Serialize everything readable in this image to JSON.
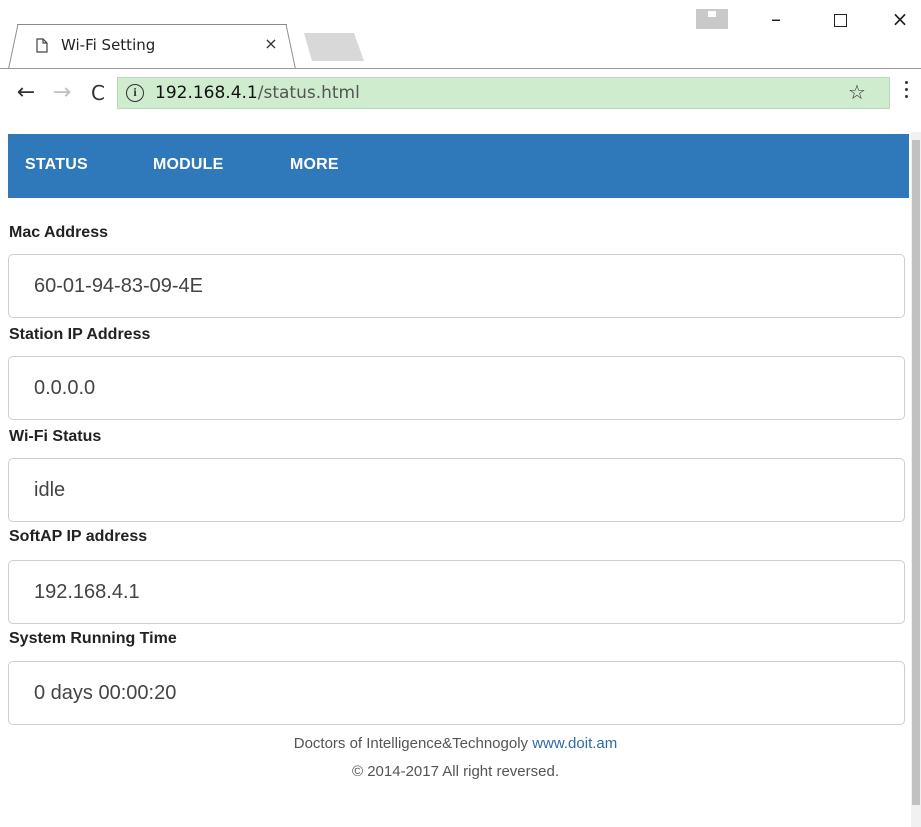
{
  "browser": {
    "tab_title": "Wi-Fi Setting",
    "tab_close": "×",
    "window_minimize": "–",
    "window_close": "×",
    "url_host": "192.168.4.1",
    "url_path": "/status.html",
    "back": "←",
    "forward": "→",
    "reload": "C",
    "info": "i",
    "star": "☆"
  },
  "nav": {
    "items": [
      {
        "label": "STATUS"
      },
      {
        "label": "MODULE"
      },
      {
        "label": "MORE"
      }
    ]
  },
  "fields": [
    {
      "label": "Mac Address",
      "value": "60-01-94-83-09-4E"
    },
    {
      "label": "Station IP Address",
      "value": "0.0.0.0"
    },
    {
      "label": "Wi-Fi Status",
      "value": "idle"
    },
    {
      "label": "SoftAP IP address",
      "value": "192.168.4.1"
    },
    {
      "label": "System Running Time",
      "value": "0 days 00:00:20"
    }
  ],
  "footer": {
    "company": "Doctors of Intelligence&Technogoly ",
    "link": "www.doit.am",
    "copyright": "© 2014-2017 All right reversed."
  },
  "colors": {
    "navbar": "#2f78b9",
    "omnibox": "#cfeccf",
    "link": "#2f6aa6"
  }
}
